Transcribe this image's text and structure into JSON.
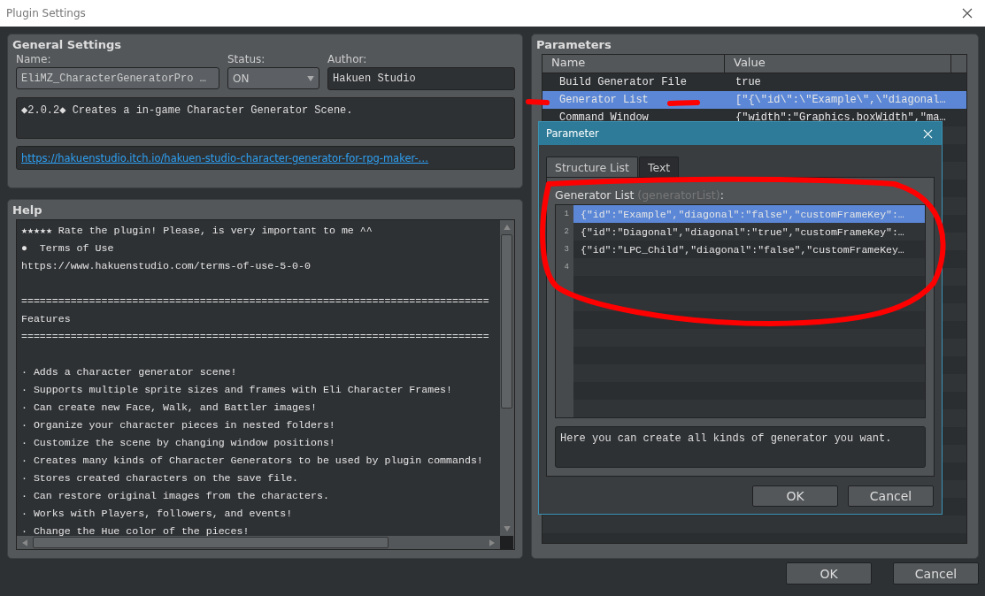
{
  "window": {
    "title": "Plugin Settings"
  },
  "general_settings": {
    "title": "General Settings",
    "name_label": "Name:",
    "name_value": "EliMZ_CharacterGeneratorPro …",
    "status_label": "Status:",
    "status_value": "ON",
    "author_label": "Author:",
    "author_value": "Hakuen Studio",
    "description": "◆2.0.2◆ Creates a in-game Character Generator Scene.",
    "url": "https://hakuenstudio.itch.io/hakuen-studio-character-generator-for-rpg-maker-…"
  },
  "help": {
    "title": "Help",
    "lines": [
      {
        "kind": "text",
        "text": "★★★★★ Rate the plugin! Please, is very important to me ^^"
      },
      {
        "kind": "text",
        "text": "●  Terms of Use"
      },
      {
        "kind": "text",
        "text": "https://www.hakuenstudio.com/terms-of-use-5-0-0"
      },
      {
        "kind": "blank"
      },
      {
        "kind": "text",
        "text": "============================================================================"
      },
      {
        "kind": "text",
        "text": "Features"
      },
      {
        "kind": "text",
        "text": "============================================================================"
      },
      {
        "kind": "blank"
      },
      {
        "kind": "text",
        "text": "· Adds a character generator scene!"
      },
      {
        "kind": "text",
        "text": "· Supports multiple sprite sizes and frames with Eli Character Frames!"
      },
      {
        "kind": "text",
        "text": "· Can create new Face, Walk, and Battler images!"
      },
      {
        "kind": "text",
        "text": "· Organize your character pieces in nested folders!"
      },
      {
        "kind": "text",
        "text": "· Customize the scene by changing window positions!"
      },
      {
        "kind": "text",
        "text": "· Creates many kinds of Character Generators to be used by plugin commands!"
      },
      {
        "kind": "text",
        "text": "· Stores created characters on the save file."
      },
      {
        "kind": "text",
        "text": "· Can restore original images from the characters."
      },
      {
        "kind": "text",
        "text": "· Works with Players, followers, and events!"
      },
      {
        "kind": "text",
        "text": "· Change the Hue color of the pieces!"
      }
    ]
  },
  "parameters": {
    "title": "Parameters",
    "columns": [
      "Name",
      "Value"
    ],
    "rows": [
      {
        "name": "Build Generator File",
        "value": "true",
        "selected": false
      },
      {
        "name": "Generator List",
        "value": "[\"{\\\"id\\\":\\\"Example\\\",\\\"diagonal…",
        "selected": true
      },
      {
        "name": "Command Window",
        "value": "{\"width\":\"Graphics.boxWidth\",\"ma…",
        "selected": false
      }
    ]
  },
  "dialog": {
    "title": "Parameter",
    "tabs": [
      {
        "label": "Structure List",
        "selected": true
      },
      {
        "label": "Text",
        "selected": false
      }
    ],
    "list_label": "Generator List",
    "list_key": "(generatorList)",
    "list_colon": ":",
    "items": [
      {
        "number": "1",
        "text": "{\"id\":\"Example\",\"diagonal\":\"false\",\"customFrameKey\":…",
        "selected": true
      },
      {
        "number": "2",
        "text": "{\"id\":\"Diagonal\",\"diagonal\":\"true\",\"customFrameKey\":…",
        "selected": false
      },
      {
        "number": "3",
        "text": "{\"id\":\"LPC_Child\",\"diagonal\":\"false\",\"customFrameKey…",
        "selected": false
      },
      {
        "number": "4",
        "selected": false
      }
    ],
    "description": "Here you can create all kinds of generator you want.",
    "buttons": [
      "OK",
      "Cancel"
    ]
  },
  "buttons": [
    "OK",
    "Cancel"
  ]
}
